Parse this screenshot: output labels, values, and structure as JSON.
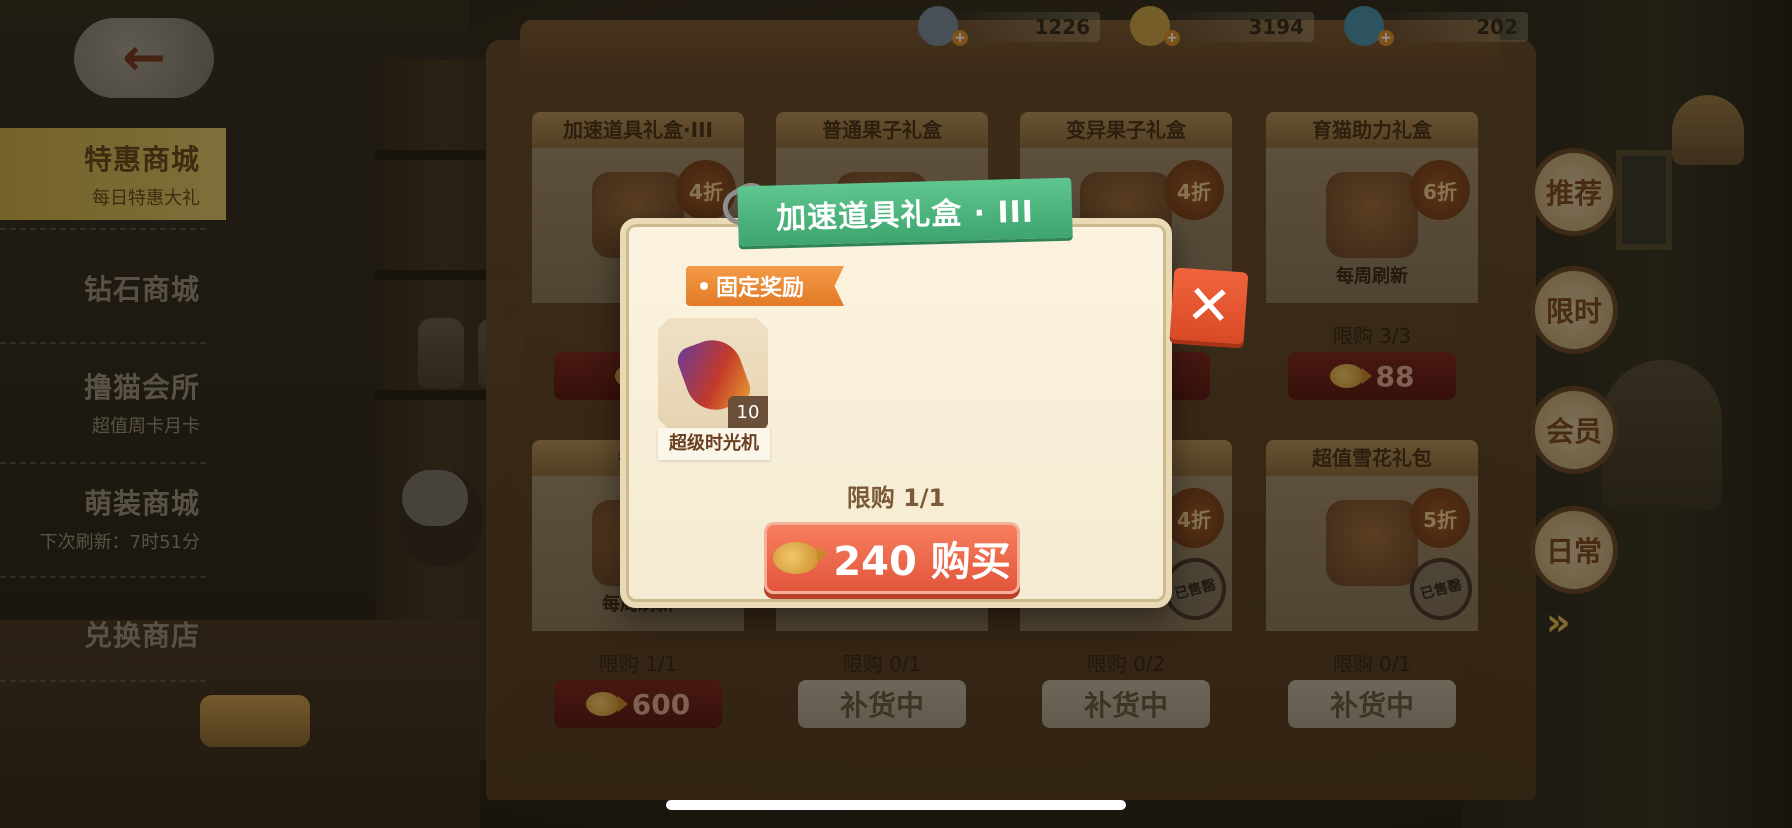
{
  "currencies": [
    {
      "icon": "gray-fish-icon",
      "value": "1226"
    },
    {
      "icon": "gold-fish-icon",
      "value": "3194"
    },
    {
      "icon": "blue-fish-icon",
      "value": "202"
    }
  ],
  "nav": [
    {
      "label": "特惠商城",
      "sub": "每日特惠大礼",
      "active": true
    },
    {
      "label": "钻石商城",
      "sub": ""
    },
    {
      "label": "撸猫会所",
      "sub": "超值周卡月卡"
    },
    {
      "label": "萌装商城",
      "sub": "下次刷新：7时51分"
    },
    {
      "label": "兑换商店",
      "sub": ""
    }
  ],
  "cards": [
    {
      "title": "加速道具礼盒·III",
      "discount": "4折",
      "refresh": "每",
      "limit": "限",
      "price": "",
      "btn": "red"
    },
    {
      "title": "普通果子礼盒",
      "discount": "",
      "refresh": "",
      "limit": "",
      "price": "",
      "btn": "red"
    },
    {
      "title": "变异果子礼盒",
      "discount": "4折",
      "refresh": "",
      "limit": "",
      "price": "",
      "btn": "red"
    },
    {
      "title": "育猫助力礼盒",
      "discount": "6折",
      "refresh": "每周刷新",
      "limit": "限购 3/3",
      "price": "88",
      "btn": "red"
    },
    {
      "title": "每周",
      "discount": "",
      "refresh": "每周刷新",
      "limit": "限购 1/1",
      "price": "600",
      "btn": "red"
    },
    {
      "title": "",
      "discount": "",
      "refresh": "",
      "limit": "限购 0/1",
      "price": "补货中",
      "btn": "cream"
    },
    {
      "title": "",
      "discount": "4折",
      "refresh": "",
      "limit": "限购 0/2",
      "price": "补货中",
      "btn": "cream",
      "stamp": "已售罄"
    },
    {
      "title": "超值雪花礼包",
      "discount": "5折",
      "refresh": "",
      "limit": "限购 0/1",
      "price": "补货中",
      "btn": "cream",
      "stamp": "已售罄"
    }
  ],
  "side_tabs": [
    "推荐",
    "限时",
    "会员",
    "日常"
  ],
  "modal": {
    "title": "加速道具礼盒 · III",
    "section_tag": "固定奖励",
    "reward": {
      "name": "超级时光机",
      "count": "10"
    },
    "limit": "限购 1/1",
    "buy_label": "240 购买"
  },
  "colors": {
    "accent_green": "#4db87e",
    "buy_red": "#ea6448",
    "tag_orange": "#ee8a36",
    "nav_active": "#d4b75a"
  }
}
